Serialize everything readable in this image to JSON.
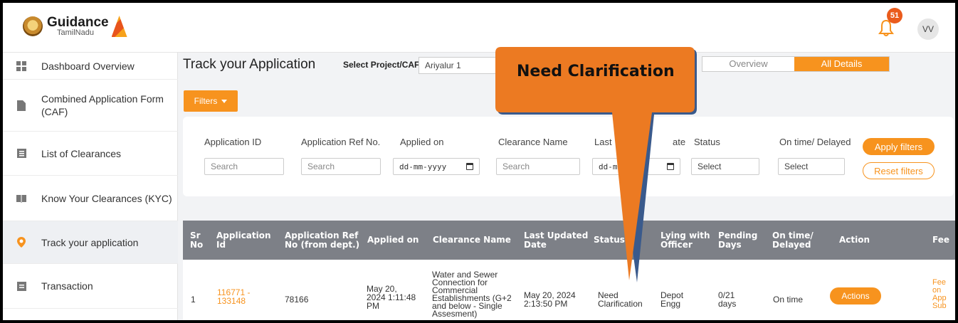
{
  "header": {
    "logo_title": "Guidance",
    "logo_subtitle": "TamilNadu",
    "notification_count": "51",
    "user_initials": "VV"
  },
  "sidebar": {
    "items": [
      {
        "label": "Dashboard Overview",
        "icon": "dashboard-icon"
      },
      {
        "label": "Combined Application Form (CAF)",
        "icon": "document-icon"
      },
      {
        "label": "List of Clearances",
        "icon": "list-icon"
      },
      {
        "label": "Know Your Clearances (KYC)",
        "icon": "book-icon"
      },
      {
        "label": "Track your application",
        "icon": "location-pin-icon",
        "active": true
      },
      {
        "label": "Transaction",
        "icon": "transaction-icon"
      }
    ]
  },
  "main": {
    "title": "Track your Application",
    "project_label": "Select Project/CAF",
    "project_value": "Ariyalur 1",
    "view_tabs": [
      "Overview",
      "All Details"
    ],
    "active_view": "All Details",
    "filters_label": "Filters"
  },
  "filters": {
    "fields": [
      {
        "label": "Application ID",
        "placeholder": "Search"
      },
      {
        "label": "Application Ref No.",
        "placeholder": "Search"
      },
      {
        "label": "Applied on",
        "placeholder": "dd-mm-yyyy"
      },
      {
        "label": "Clearance Name",
        "placeholder": "Search"
      },
      {
        "label": "Last",
        "label_tail": "ate",
        "placeholder": "dd-m"
      },
      {
        "label": "Status",
        "placeholder": "Select"
      },
      {
        "label": "On time/ Delayed",
        "placeholder": "Select"
      }
    ],
    "apply_label": "Apply filters",
    "reset_label": "Reset filters"
  },
  "table": {
    "headers": [
      "Sr No",
      "Application Id",
      "Application Ref No (from dept.)",
      "Applied on",
      "Clearance Name",
      "Last Updated Date",
      "Status",
      "Lying with Officer",
      "Pending Days",
      "On time/ Delayed",
      "Action",
      "Fee"
    ],
    "rows": [
      {
        "sr": "1",
        "app_id": "116771 - 133148",
        "ref_no": "78166",
        "applied_on": "May 20, 2024 1:11:48 PM",
        "clearance": "Water and Sewer Connection for Commercial Establishments (G+2 and below - Single Assesment)",
        "last_updated": "May 20, 2024 2:13:50 PM",
        "status": "Need Clarification",
        "officer": "Depot Engg",
        "pending": "0/21 days",
        "ontime": "On time",
        "action": "Actions",
        "fee": "Fee on App Sub"
      }
    ]
  },
  "callout": {
    "text": "Need Clarification"
  },
  "colors": {
    "accent": "#f7931e",
    "callout": "#ec7a22",
    "table_header": "#7d8087",
    "notification": "#ea5b1c"
  }
}
